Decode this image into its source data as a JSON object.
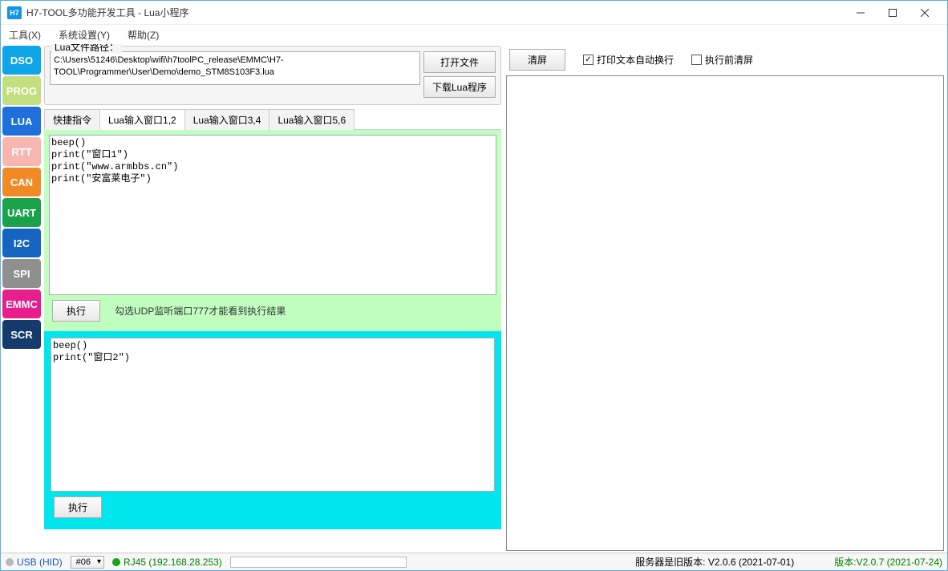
{
  "title": "H7-TOOL多功能开发工具 - Lua小程序",
  "app_icon": "H7",
  "menus": {
    "tools": "工具(X)",
    "sys": "系统设置(Y)",
    "help": "帮助(Z)"
  },
  "sidebar": [
    {
      "label": "DSO",
      "bg": "#0ea5e9"
    },
    {
      "label": "PROG",
      "bg": "#c3de7e"
    },
    {
      "label": "LUA",
      "bg": "#1e6fd9"
    },
    {
      "label": "RTT",
      "bg": "#f7b7b0"
    },
    {
      "label": "CAN",
      "bg": "#f08a24"
    },
    {
      "label": "UART",
      "bg": "#1aa24a"
    },
    {
      "label": "I2C",
      "bg": "#1565c0"
    },
    {
      "label": "SPI",
      "bg": "#8f8f8f"
    },
    {
      "label": "EMMC",
      "bg": "#e91e8c"
    },
    {
      "label": "SCR",
      "bg": "#153a6b"
    }
  ],
  "path_group": {
    "legend": "Lua文件路径：",
    "value": "C:\\Users\\51246\\Desktop\\wifi\\h7toolPC_release\\EMMC\\H7-TOOL\\Programmer\\User\\Demo\\demo_STM8S103F3.lua",
    "open_btn": "打开文件",
    "download_btn": "下载Lua程序"
  },
  "tabs": {
    "t1": "快捷指令",
    "t2": "Lua输入窗口1,2",
    "t3": "Lua输入窗口3,4",
    "t4": "Lua输入窗口5,6",
    "active": 1
  },
  "code1": "beep()\nprint(\"窗口1\")\nprint(\"www.armbbs.cn\")\nprint(\"安富莱电子\")",
  "code2": "beep()\nprint(\"窗口2\")",
  "exec_label": "执行",
  "hint": "勾选UDP监听端口777才能看到执行结果",
  "right": {
    "clear_btn": "清屏",
    "wrap_chk_label": "打印文本自动换行",
    "wrap_checked": true,
    "preclear_label": "执行前清屏",
    "preclear_checked": false,
    "output": ""
  },
  "status": {
    "usb_color": "#b9b9b9",
    "usb_label": "USB (HID)",
    "combo_value": "#06",
    "rj45_color": "#17a31a",
    "rj45_label": "RJ45 (192.168.28.253)",
    "server_msg": "服务器是旧版本: V2.0.6 (2021-07-01)",
    "version": "版本:V2.0.7 (2021-07-24)"
  }
}
